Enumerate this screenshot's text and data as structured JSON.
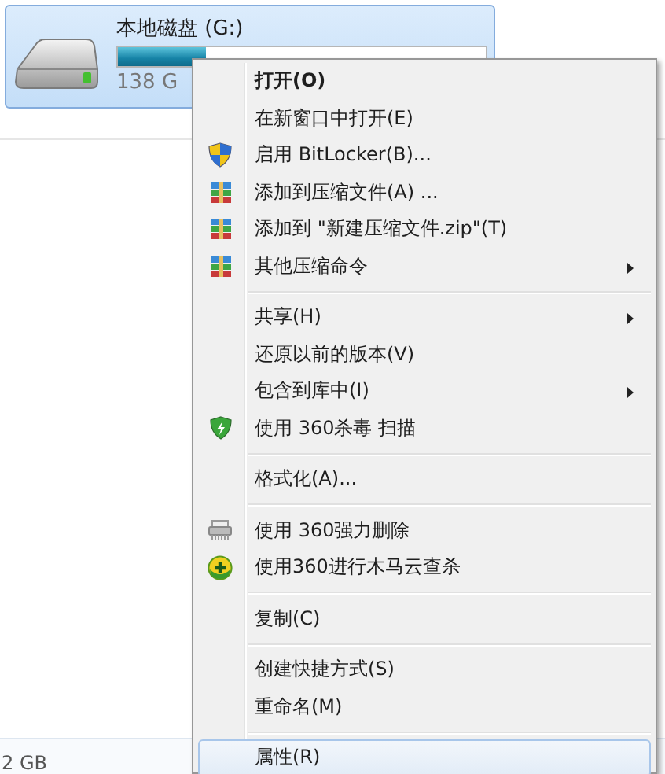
{
  "drive": {
    "name": "本地磁盘 (G:)",
    "level": 0.24,
    "size": "138 G",
    "selected": true
  },
  "status_text": "2 GB",
  "context_menu": [
    {
      "kind": "item",
      "label": "打开(O)",
      "bold": true,
      "submenu": false,
      "selected": false
    },
    {
      "kind": "item",
      "label": "在新窗口中打开(E)",
      "bold": false,
      "submenu": false,
      "selected": false
    },
    {
      "kind": "item",
      "label": "启用 BitLocker(B)...",
      "bold": false,
      "submenu": false,
      "selected": false
    },
    {
      "kind": "item",
      "label": "添加到压缩文件(A) ...",
      "bold": false,
      "submenu": false,
      "selected": false
    },
    {
      "kind": "item",
      "label": "添加到 \"新建压缩文件.zip\"(T)",
      "bold": false,
      "submenu": false,
      "selected": false
    },
    {
      "kind": "item",
      "label": "其他压缩命令",
      "bold": false,
      "submenu": true,
      "selected": false
    },
    {
      "kind": "separator"
    },
    {
      "kind": "item",
      "label": "共享(H)",
      "bold": false,
      "submenu": true,
      "selected": false
    },
    {
      "kind": "item",
      "label": "还原以前的版本(V)",
      "bold": false,
      "submenu": false,
      "selected": false
    },
    {
      "kind": "item",
      "label": "包含到库中(I)",
      "bold": false,
      "submenu": true,
      "selected": false
    },
    {
      "kind": "item",
      "label": "使用 360杀毒 扫描",
      "bold": false,
      "submenu": false,
      "selected": false
    },
    {
      "kind": "separator"
    },
    {
      "kind": "item",
      "label": "格式化(A)...",
      "bold": false,
      "submenu": false,
      "selected": false
    },
    {
      "kind": "separator"
    },
    {
      "kind": "item",
      "label": "使用 360强力删除",
      "bold": false,
      "submenu": false,
      "selected": false
    },
    {
      "kind": "item",
      "label": "使用360进行木马云查杀",
      "bold": false,
      "submenu": false,
      "selected": false
    },
    {
      "kind": "separator"
    },
    {
      "kind": "item",
      "label": "复制(C)",
      "bold": false,
      "submenu": false,
      "selected": false
    },
    {
      "kind": "separator"
    },
    {
      "kind": "item",
      "label": "创建快捷方式(S)",
      "bold": false,
      "submenu": false,
      "selected": false
    },
    {
      "kind": "item",
      "label": "重命名(M)",
      "bold": false,
      "submenu": false,
      "selected": false
    },
    {
      "kind": "separator"
    },
    {
      "kind": "item",
      "label": "属性(R)",
      "bold": false,
      "submenu": false,
      "selected": true
    }
  ]
}
